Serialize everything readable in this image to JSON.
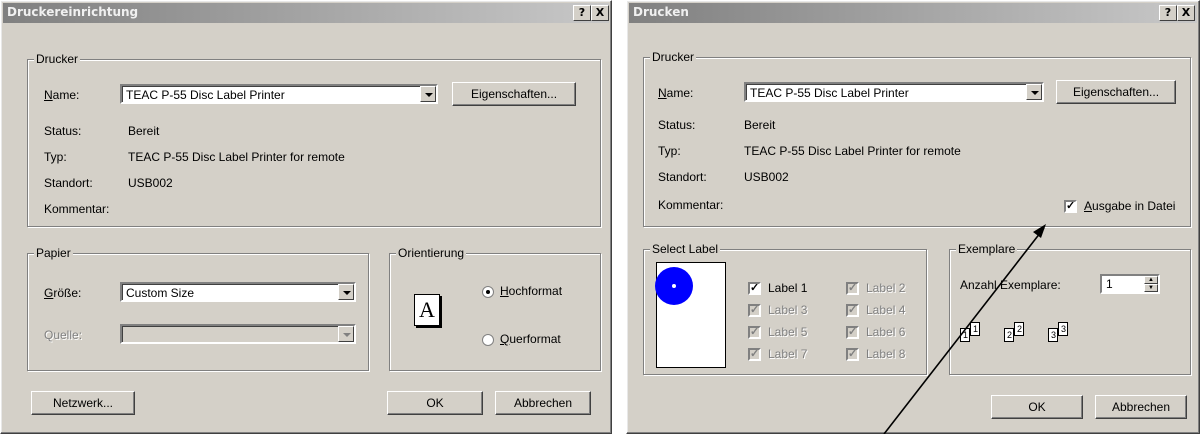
{
  "left_dialog": {
    "title": "Druckereinrichtung",
    "help_btn": "?",
    "close_btn": "X",
    "drucker": {
      "legend": "Drucker",
      "name_label": "Name:",
      "name_value": "TEAC P-55 Disc Label Printer",
      "properties_btn": "Eigenschaften...",
      "status_label": "Status:",
      "status_value": "Bereit",
      "typ_label": "Typ:",
      "typ_value": "TEAC P-55 Disc Label Printer for remote",
      "standort_label": "Standort:",
      "standort_value": "USB002",
      "kommentar_label": "Kommentar:"
    },
    "papier": {
      "legend": "Papier",
      "groesse_label": "Größe:",
      "groesse_value": "Custom Size",
      "quelle_label": "Quelle:"
    },
    "orientierung": {
      "legend": "Orientierung",
      "icon_letter": "A",
      "hoch": "Hochformat",
      "quer": "Querformat",
      "selected": "Hochformat"
    },
    "netzwerk_btn": "Netzwerk...",
    "ok_btn": "OK",
    "cancel_btn": "Abbrechen"
  },
  "right_dialog": {
    "title": "Drucken",
    "help_btn": "?",
    "close_btn": "X",
    "drucker": {
      "legend": "Drucker",
      "name_label": "Name:",
      "name_value": "TEAC P-55 Disc Label Printer",
      "properties_btn": "Eigenschaften...",
      "status_label": "Status:",
      "status_value": "Bereit",
      "typ_label": "Typ:",
      "typ_value": "TEAC P-55 Disc Label Printer for remote",
      "standort_label": "Standort:",
      "standort_value": "USB002",
      "kommentar_label": "Kommentar:",
      "file_output_label": "Ausgabe in Datei",
      "file_output_checked": true
    },
    "select_label": {
      "legend": "Select Label",
      "labels": [
        {
          "text": "Label 1",
          "checked": true,
          "enabled": true
        },
        {
          "text": "Label 2",
          "checked": true,
          "enabled": false
        },
        {
          "text": "Label 3",
          "checked": true,
          "enabled": false
        },
        {
          "text": "Label 4",
          "checked": true,
          "enabled": false
        },
        {
          "text": "Label 5",
          "checked": true,
          "enabled": false
        },
        {
          "text": "Label 6",
          "checked": true,
          "enabled": false
        },
        {
          "text": "Label 7",
          "checked": true,
          "enabled": false
        },
        {
          "text": "Label 8",
          "checked": true,
          "enabled": false
        }
      ],
      "preview_color": "#0000ff"
    },
    "exemplare": {
      "legend": "Exemplare",
      "anzahl_label": "Anzahl Exemplare:",
      "anzahl_value": "1",
      "page_numbers": [
        "1",
        "1",
        "2",
        "2",
        "3",
        "3"
      ]
    },
    "ok_btn": "OK",
    "cancel_btn": "Abbrechen"
  }
}
